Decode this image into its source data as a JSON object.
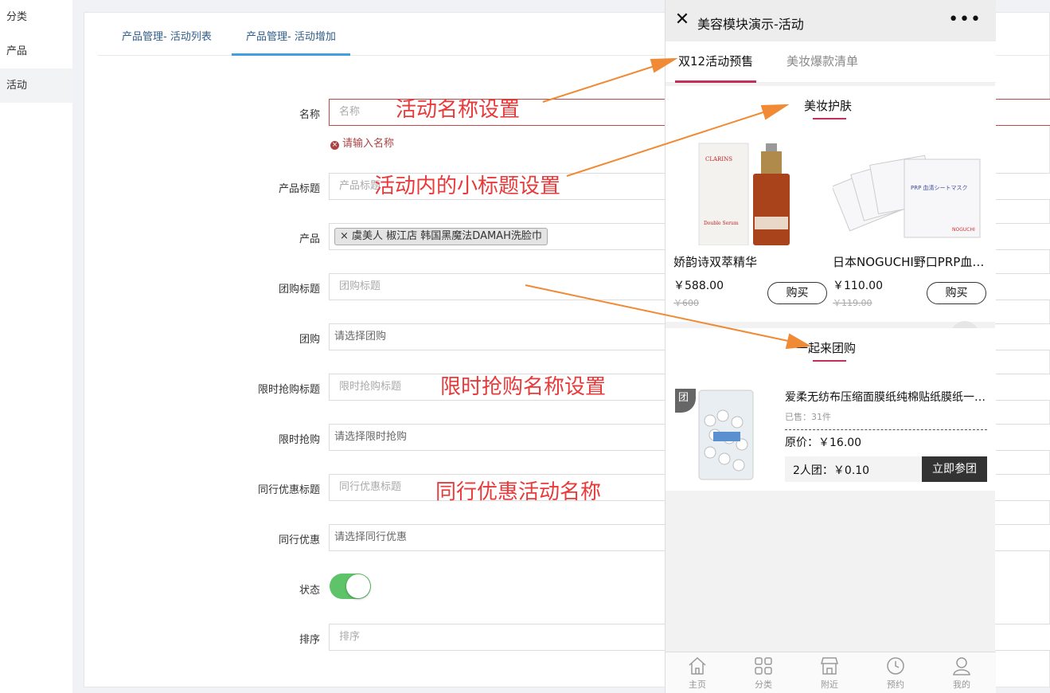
{
  "sidebar": {
    "items": [
      {
        "label": "分类"
      },
      {
        "label": "产品"
      },
      {
        "label": "活动"
      }
    ]
  },
  "tabs": [
    {
      "label": "产品管理- 活动列表"
    },
    {
      "label": "产品管理- 活动增加"
    }
  ],
  "form": {
    "name": {
      "label": "名称",
      "placeholder": "名称",
      "error": "请输入名称"
    },
    "product_title": {
      "label": "产品标题",
      "placeholder": "产品标题"
    },
    "product": {
      "label": "产品",
      "tag": "× 虞美人 椒江店 韩国黑魔法DAMAH洗脸巾"
    },
    "group_title": {
      "label": "团购标题",
      "placeholder": "团购标题"
    },
    "group": {
      "label": "团购",
      "value": "请选择团购"
    },
    "flash_title": {
      "label": "限时抢购标题",
      "placeholder": "限时抢购标题"
    },
    "flash": {
      "label": "限时抢购",
      "value": "请选择限时抢购"
    },
    "peer_title": {
      "label": "同行优惠标题",
      "placeholder": "同行优惠标题"
    },
    "peer": {
      "label": "同行优惠",
      "value": "请选择同行优惠"
    },
    "status": {
      "label": "状态"
    },
    "sort": {
      "label": "排序",
      "placeholder": "排序"
    }
  },
  "annotations": {
    "name": "活动名称设置",
    "subtitle": "活动内的小标题设置",
    "flash": "限时抢购名称设置",
    "peer": "同行优惠活动名称"
  },
  "phone": {
    "title": "美容模块演示-活动",
    "more": "•••",
    "tabs": [
      {
        "label": "双12活动预售"
      },
      {
        "label": "美妆爆款清单"
      }
    ],
    "section1_title": "美妆护肤",
    "products": [
      {
        "name": "娇韵诗双萃精华",
        "price": "￥588.00",
        "old_price": "￥600",
        "buy": "购买"
      },
      {
        "name": "日本NOGUCHI野口PRP血清面膜",
        "price": "￥110.00",
        "old_price": "￥119.00",
        "buy": "购买"
      }
    ],
    "section2_title": "一起来团购",
    "group_item": {
      "badge": "团",
      "name": "爱柔无纺布压缩面膜纸纯棉贴纸膜纸一次性",
      "sold": "已售：31件",
      "orig_price": "原价：￥16.00",
      "group_price": "2人团：￥0.10",
      "join": "立即参团"
    },
    "nav": [
      {
        "label": "主页"
      },
      {
        "label": "分类"
      },
      {
        "label": "附近"
      },
      {
        "label": "预约"
      },
      {
        "label": "我的"
      }
    ]
  },
  "colors": {
    "accent_red": "#e83a3a",
    "arrow_orange": "#f08a34",
    "toggle_green": "#5fc36a",
    "tab_blue": "#3f9fe0",
    "phone_accent": "#c2305a"
  }
}
